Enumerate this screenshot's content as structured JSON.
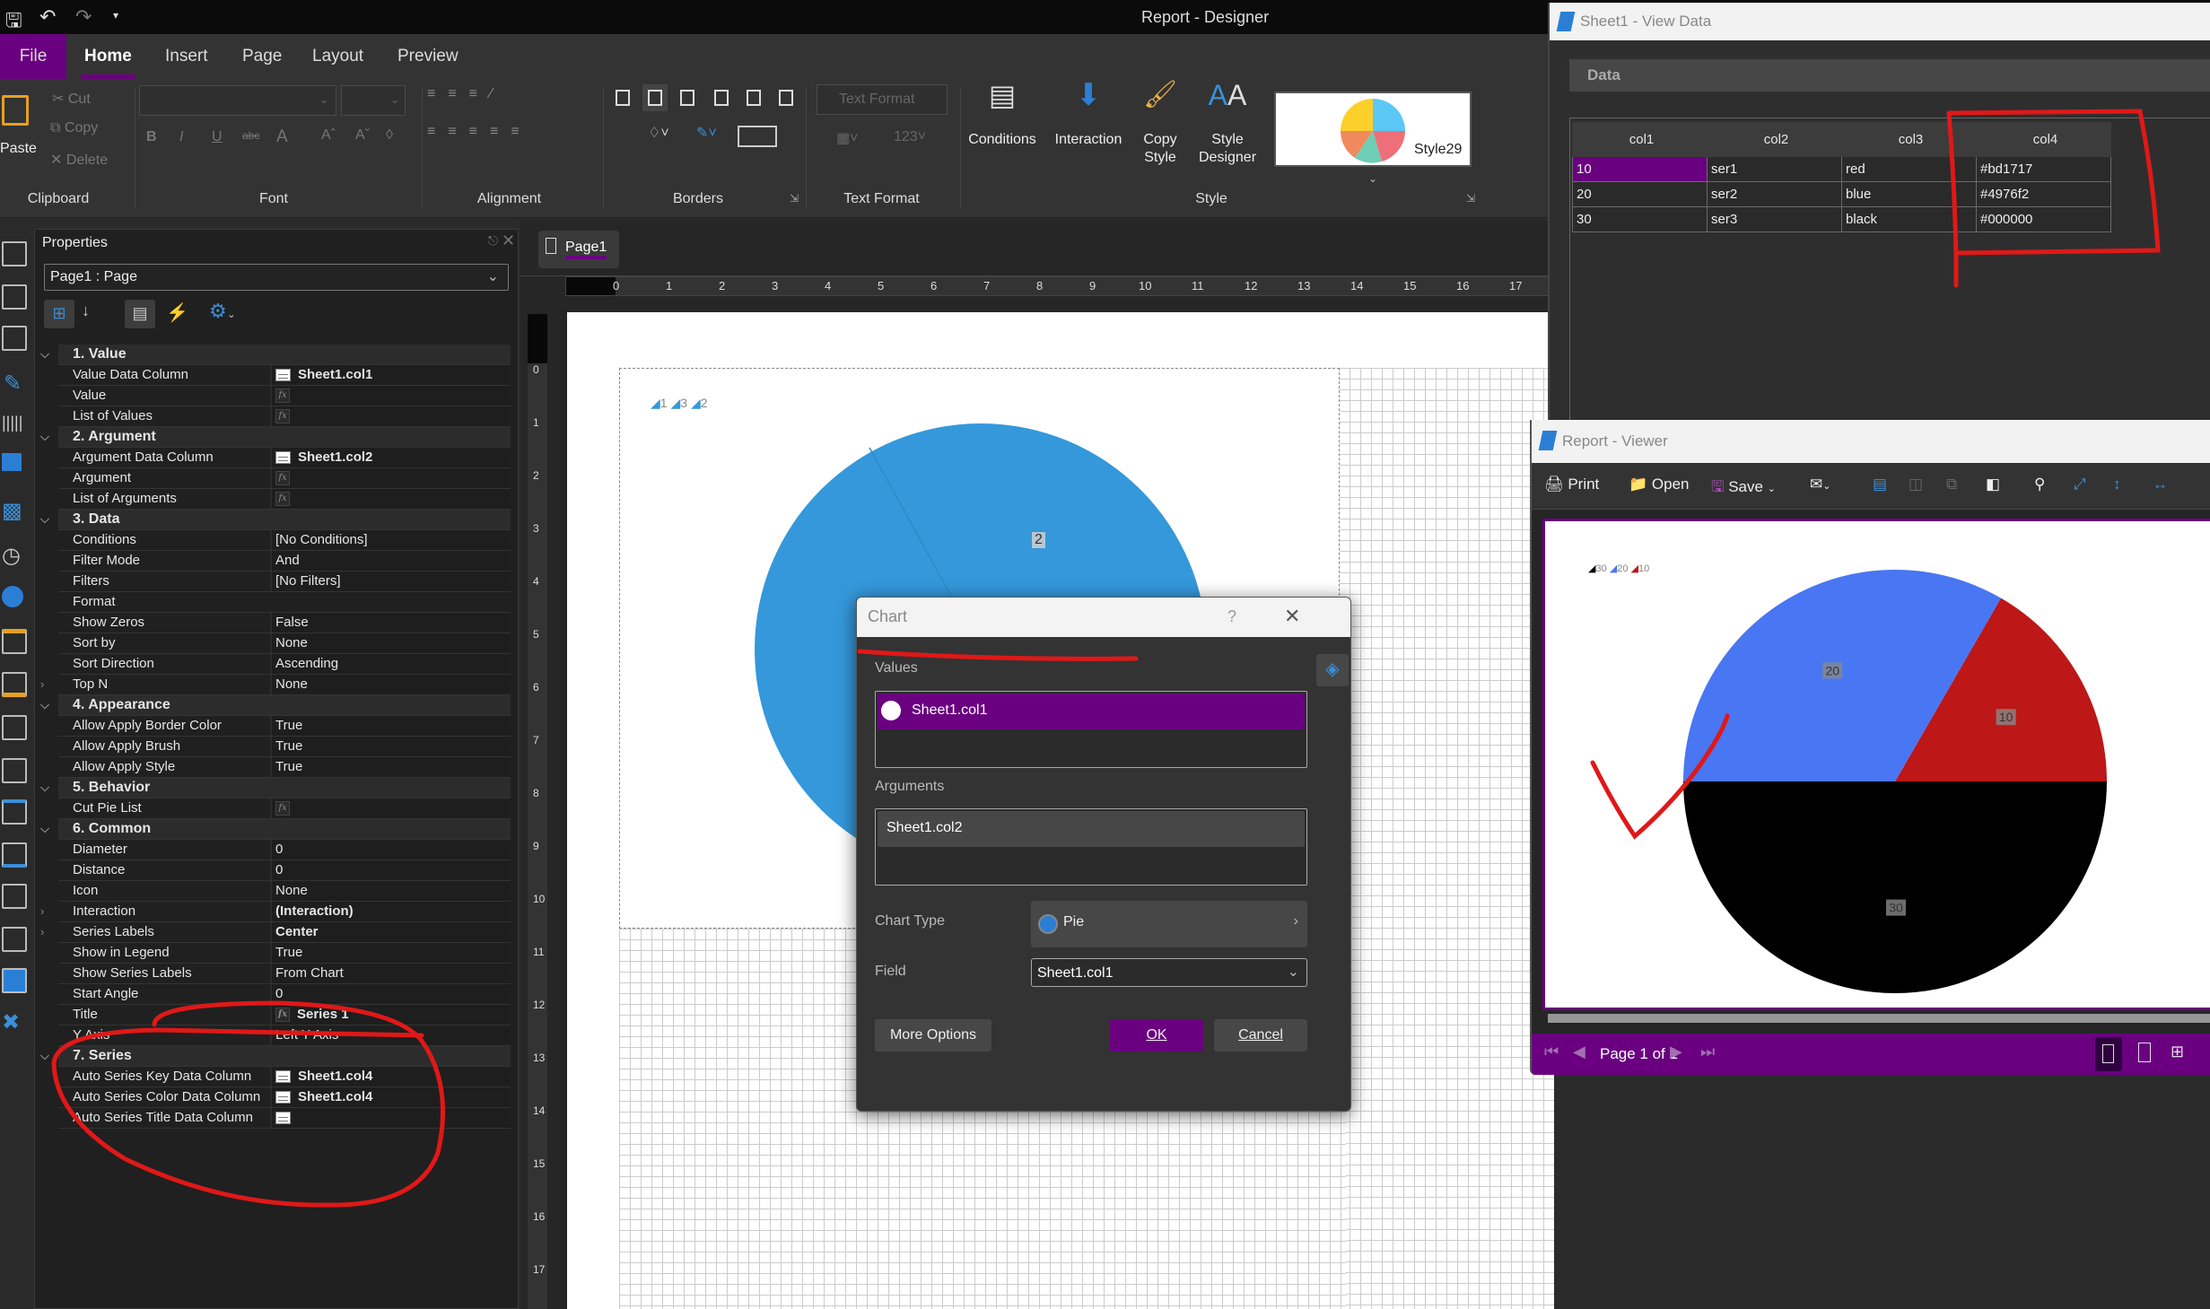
{
  "window": {
    "title": "Report - Designer"
  },
  "menu_tabs": [
    {
      "label": "File"
    },
    {
      "label": "Home"
    },
    {
      "label": "Insert"
    },
    {
      "label": "Page"
    },
    {
      "label": "Layout"
    },
    {
      "label": "Preview"
    }
  ],
  "ribbon": {
    "clipboard": {
      "label": "Clipboard",
      "paste": "Paste",
      "cut": "Cut",
      "copy": "Copy",
      "delete": "Delete"
    },
    "font": {
      "label": "Font"
    },
    "alignment": {
      "label": "Alignment"
    },
    "borders": {
      "label": "Borders"
    },
    "text_format": {
      "label": "Text Format",
      "combo": "Text Format"
    },
    "style": {
      "label": "Style",
      "conditions": "Conditions",
      "interaction": "Interaction",
      "copy_style": "Copy Style",
      "style_designer": "Style Designer",
      "gallery_item": "Style29"
    }
  },
  "properties": {
    "title": "Properties",
    "selected_object": "Page1 : Page",
    "rows": [
      {
        "type": "group",
        "name": "1. Value"
      },
      {
        "type": "prop",
        "name": "Value Data Column",
        "value": "Sheet1.col1",
        "icon": "column",
        "bold": true
      },
      {
        "type": "prop",
        "name": "Value",
        "value": "",
        "icon": "fx"
      },
      {
        "type": "prop",
        "name": "List of Values",
        "value": "",
        "icon": "fx"
      },
      {
        "type": "group",
        "name": "2. Argument"
      },
      {
        "type": "prop",
        "name": "Argument Data Column",
        "value": "Sheet1.col2",
        "icon": "column",
        "bold": true
      },
      {
        "type": "prop",
        "name": "Argument",
        "value": "",
        "icon": "fx"
      },
      {
        "type": "prop",
        "name": "List of Arguments",
        "value": "",
        "icon": "fx"
      },
      {
        "type": "group",
        "name": "3. Data"
      },
      {
        "type": "prop",
        "name": "Conditions",
        "value": "[No Conditions]"
      },
      {
        "type": "prop",
        "name": "Filter Mode",
        "value": "And"
      },
      {
        "type": "prop",
        "name": "Filters",
        "value": "[No Filters]"
      },
      {
        "type": "prop",
        "name": "Format",
        "value": ""
      },
      {
        "type": "prop",
        "name": "Show Zeros",
        "value": "False"
      },
      {
        "type": "prop",
        "name": "Sort by",
        "value": "None"
      },
      {
        "type": "prop",
        "name": "Sort Direction",
        "value": "Ascending"
      },
      {
        "type": "prop",
        "name": "Top N",
        "value": "None",
        "expander": true
      },
      {
        "type": "group",
        "name": "4. Appearance"
      },
      {
        "type": "prop",
        "name": "Allow Apply Border Color",
        "value": "True"
      },
      {
        "type": "prop",
        "name": "Allow Apply Brush",
        "value": "True"
      },
      {
        "type": "prop",
        "name": "Allow Apply Style",
        "value": "True"
      },
      {
        "type": "group",
        "name": "5. Behavior"
      },
      {
        "type": "prop",
        "name": "Cut Pie List",
        "value": "",
        "icon": "fx"
      },
      {
        "type": "group",
        "name": "6. Common"
      },
      {
        "type": "prop",
        "name": "Diameter",
        "value": "0"
      },
      {
        "type": "prop",
        "name": "Distance",
        "value": "0"
      },
      {
        "type": "prop",
        "name": "Icon",
        "value": "None"
      },
      {
        "type": "prop",
        "name": "Interaction",
        "value": "(Interaction)",
        "bold": true,
        "expander": true
      },
      {
        "type": "prop",
        "name": "Series Labels",
        "value": "Center",
        "bold": true,
        "expander": true
      },
      {
        "type": "prop",
        "name": "Show in Legend",
        "value": "True"
      },
      {
        "type": "prop",
        "name": "Show Series Labels",
        "value": "From Chart"
      },
      {
        "type": "prop",
        "name": "Start Angle",
        "value": "0"
      },
      {
        "type": "prop",
        "name": "Title",
        "value": "Series 1",
        "icon": "fx",
        "bold": true
      },
      {
        "type": "prop",
        "name": "Y Axis",
        "value": "Left Y Axis"
      },
      {
        "type": "group",
        "name": "7. Series"
      },
      {
        "type": "prop",
        "name": "Auto Series Key Data Column",
        "value": "Sheet1.col4",
        "icon": "column",
        "bold": true
      },
      {
        "type": "prop",
        "name": "Auto Series Color Data Column",
        "value": "Sheet1.col4",
        "icon": "column",
        "bold": true
      },
      {
        "type": "prop",
        "name": "Auto Series Title Data Column",
        "value": "",
        "icon": "column"
      }
    ]
  },
  "designer": {
    "page_tab": "Page1",
    "ruler_h": [
      "0",
      "1",
      "2",
      "3",
      "4",
      "5",
      "6",
      "7",
      "8",
      "9",
      "10",
      "11",
      "12",
      "13",
      "14",
      "15",
      "16",
      "17"
    ],
    "ruler_v": [
      "0",
      "1",
      "2",
      "3",
      "4",
      "5",
      "6",
      "7",
      "8",
      "9",
      "10",
      "11",
      "12",
      "13",
      "14",
      "15",
      "16",
      "17"
    ],
    "chart_legend": [
      "1",
      "3",
      "2"
    ],
    "chart_label": "2",
    "chart_color": "#3498db"
  },
  "chart_dialog": {
    "title": "Chart",
    "help": "?",
    "values_label": "Values",
    "values": [
      "Sheet1.col1"
    ],
    "arguments_label": "Arguments",
    "arguments": [
      "Sheet1.col2"
    ],
    "chart_type_label": "Chart Type",
    "chart_type": "Pie",
    "field_label": "Field",
    "field": "Sheet1.col1",
    "more_options": "More Options",
    "ok": "OK",
    "cancel": "Cancel"
  },
  "view_data": {
    "title": "Sheet1 - View Data",
    "section": "Data",
    "columns": [
      "col1",
      "col2",
      "col3",
      "col4"
    ],
    "rows": [
      [
        "10",
        "ser1",
        "red",
        "#bd1717"
      ],
      [
        "20",
        "ser2",
        "blue",
        "#4976f2"
      ],
      [
        "30",
        "ser3",
        "black",
        "#000000"
      ]
    ]
  },
  "viewer": {
    "title": "Report - Viewer",
    "toolbar": {
      "print": "Print",
      "open": "Open",
      "save": "Save"
    },
    "page_status": "Page 1 of 1"
  },
  "chart_data": {
    "type": "pie",
    "categories": [
      "30",
      "20",
      "10"
    ],
    "values": [
      30,
      20,
      10
    ],
    "colors": [
      "#000000",
      "#4976f2",
      "#bd1717"
    ],
    "start_angle": 0,
    "legend": "top-left",
    "labels": [
      "30",
      "20",
      "10"
    ]
  },
  "accent": "#6a0080"
}
